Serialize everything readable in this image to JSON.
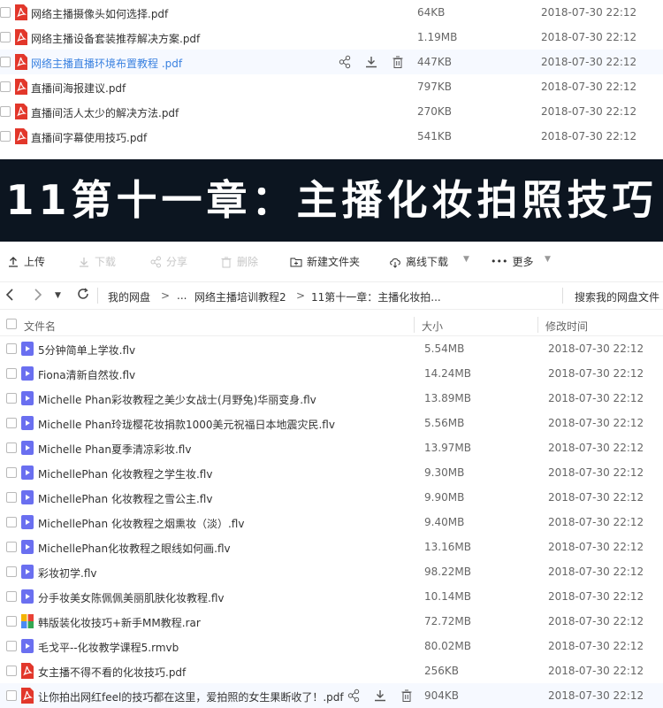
{
  "top_files": [
    {
      "name": "网络主播摄像头如何选择.pdf",
      "size": "64KB",
      "date": "2018-07-30 22:12",
      "type": "pdf"
    },
    {
      "name": "网络主播设备套装推荐解决方案.pdf",
      "size": "1.19MB",
      "date": "2018-07-30 22:12",
      "type": "pdf"
    },
    {
      "name": "网络主播直播环境布置教程 .pdf",
      "size": "447KB",
      "date": "2018-07-30 22:12",
      "type": "pdf",
      "hover": true
    },
    {
      "name": "直播间海报建议.pdf",
      "size": "797KB",
      "date": "2018-07-30 22:12",
      "type": "pdf"
    },
    {
      "name": "直播间活人太少的解决方法.pdf",
      "size": "270KB",
      "date": "2018-07-30 22:12",
      "type": "pdf"
    },
    {
      "name": "直播间字幕使用技巧.pdf",
      "size": "541KB",
      "date": "2018-07-30 22:12",
      "type": "pdf"
    }
  ],
  "banner": {
    "title": "11第十一章：主播化妆拍照技巧"
  },
  "toolbar": {
    "upload": "上传",
    "download": "下载",
    "share": "分享",
    "delete": "删除",
    "new_folder": "新建文件夹",
    "offline_download": "离线下载",
    "more": "更多"
  },
  "nav": {
    "crumb_root": "我的网盘",
    "crumb_sep": ">",
    "crumb_ellipsis": "...",
    "crumb_parent": "网络主播培训教程2",
    "crumb_current": "11第十一章：主播化妆拍...",
    "search_label": "搜索我的网盘文件"
  },
  "columns": {
    "name": "文件名",
    "size": "大小",
    "modified": "修改时间"
  },
  "files": [
    {
      "name": "5分钟简单上学妆.flv",
      "size": "5.54MB",
      "date": "2018-07-30 22:12",
      "type": "video"
    },
    {
      "name": "Fiona清新自然妆.flv",
      "size": "14.24MB",
      "date": "2018-07-30 22:12",
      "type": "video"
    },
    {
      "name": "Michelle Phan彩妆教程之美少女战士(月野兔)华丽变身.flv",
      "size": "13.89MB",
      "date": "2018-07-30 22:12",
      "type": "video"
    },
    {
      "name": "Michelle Phan玲珑樱花妆捐款1000美元祝福日本地震灾民.flv",
      "size": "5.56MB",
      "date": "2018-07-30 22:12",
      "type": "video"
    },
    {
      "name": "Michelle Phan夏季清凉彩妆.flv",
      "size": "13.97MB",
      "date": "2018-07-30 22:12",
      "type": "video"
    },
    {
      "name": "MichellePhan 化妆教程之学生妆.flv",
      "size": "9.30MB",
      "date": "2018-07-30 22:12",
      "type": "video"
    },
    {
      "name": "MichellePhan 化妆教程之雪公主.flv",
      "size": "9.90MB",
      "date": "2018-07-30 22:12",
      "type": "video"
    },
    {
      "name": "MichellePhan 化妆教程之烟熏妆（淡）.flv",
      "size": "9.40MB",
      "date": "2018-07-30 22:12",
      "type": "video"
    },
    {
      "name": "MichellePhan化妆教程之眼线如何画.flv",
      "size": "13.16MB",
      "date": "2018-07-30 22:12",
      "type": "video"
    },
    {
      "name": "彩妆初学.flv",
      "size": "98.22MB",
      "date": "2018-07-30 22:12",
      "type": "video"
    },
    {
      "name": "分手妆美女陈佩佩美丽肌肤化妆教程.flv",
      "size": "10.14MB",
      "date": "2018-07-30 22:12",
      "type": "video"
    },
    {
      "name": "韩版装化妆技巧+新手MM教程.rar",
      "size": "72.72MB",
      "date": "2018-07-30 22:12",
      "type": "rar"
    },
    {
      "name": "毛戈平--化妆教学课程5.rmvb",
      "size": "80.02MB",
      "date": "2018-07-30 22:12",
      "type": "video"
    },
    {
      "name": "女主播不得不看的化妆技巧.pdf",
      "size": "256KB",
      "date": "2018-07-30 22:12",
      "type": "pdf"
    },
    {
      "name": "让你拍出网红feel的技巧都在这里，爱拍照的女生果断收了！.pdf",
      "size": "904KB",
      "date": "2018-07-30 22:12",
      "type": "pdf",
      "hover": true
    }
  ],
  "colors": {
    "pdf": "#e2372b",
    "video": "#6a6ff0",
    "link": "#3b82e0",
    "banner_bg": "#0c1520"
  }
}
